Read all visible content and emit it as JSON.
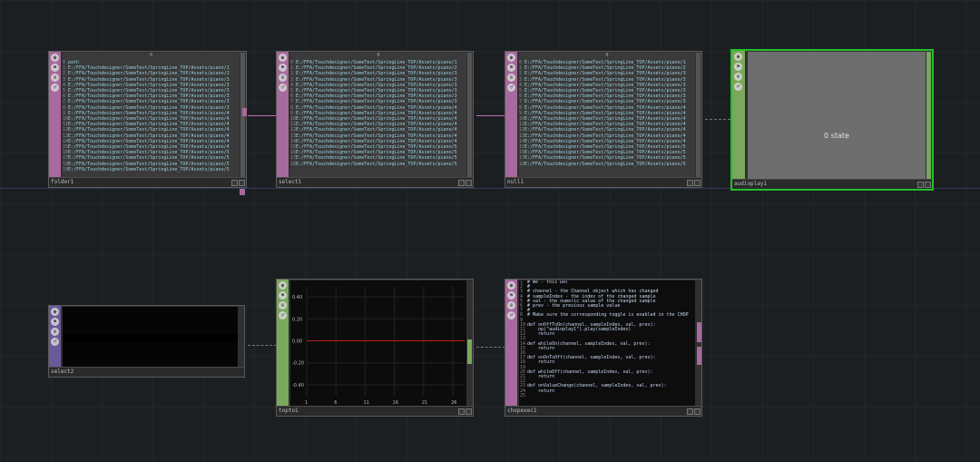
{
  "colors": {
    "dat": "#a66a9e",
    "chop": "#7aa85c",
    "selected": "#22c02a",
    "wire_dat": "#c46aae",
    "wire_chop": "#888888"
  },
  "nodes": {
    "folder1": {
      "name": "folder1",
      "header": "0",
      "rows": [
        "path",
        "E:/FFA/Touchdesigner/SomeTest/SpringLine_TOP/Assets/piano/1",
        "E:/FFA/Touchdesigner/SomeTest/SpringLine_TOP/Assets/piano/2",
        "E:/FFA/Touchdesigner/SomeTest/SpringLine_TOP/Assets/piano/3",
        "E:/FFA/Touchdesigner/SomeTest/SpringLine_TOP/Assets/piano/3",
        "E:/FFA/Touchdesigner/SomeTest/SpringLine_TOP/Assets/piano/3",
        "E:/FFA/Touchdesigner/SomeTest/SpringLine_TOP/Assets/piano/3",
        "E:/FFA/Touchdesigner/SomeTest/SpringLine_TOP/Assets/piano/3",
        "E:/FFA/Touchdesigner/SomeTest/SpringLine_TOP/Assets/piano/3",
        "E:/FFA/Touchdesigner/SomeTest/SpringLine_TOP/Assets/piano/4",
        "E:/FFA/Touchdesigner/SomeTest/SpringLine_TOP/Assets/piano/4",
        "E:/FFA/Touchdesigner/SomeTest/SpringLine_TOP/Assets/piano/4",
        "E:/FFA/Touchdesigner/SomeTest/SpringLine_TOP/Assets/piano/4",
        "E:/FFA/Touchdesigner/SomeTest/SpringLine_TOP/Assets/piano/4",
        "E:/FFA/Touchdesigner/SomeTest/SpringLine_TOP/Assets/piano/4",
        "E:/FFA/Touchdesigner/SomeTest/SpringLine_TOP/Assets/piano/4",
        "E:/FFA/Touchdesigner/SomeTest/SpringLine_TOP/Assets/piano/5",
        "E:/FFA/Touchdesigner/SomeTest/SpringLine_TOP/Assets/piano/5",
        "E:/FFA/Touchdesigner/SomeTest/SpringLine_TOP/Assets/piano/5",
        "E:/FFA/Touchdesigner/SomeTest/SpringLine_TOP/Assets/piano/5"
      ]
    },
    "select1": {
      "name": "select1",
      "header": "0",
      "rows": [
        "E:/FFA/Touchdesigner/SomeTest/SpringLine_TOP/Assets/piano/1",
        "E:/FFA/Touchdesigner/SomeTest/SpringLine_TOP/Assets/piano/2",
        "E:/FFA/Touchdesigner/SomeTest/SpringLine_TOP/Assets/piano/3",
        "E:/FFA/Touchdesigner/SomeTest/SpringLine_TOP/Assets/piano/3",
        "E:/FFA/Touchdesigner/SomeTest/SpringLine_TOP/Assets/piano/3",
        "E:/FFA/Touchdesigner/SomeTest/SpringLine_TOP/Assets/piano/3",
        "E:/FFA/Touchdesigner/SomeTest/SpringLine_TOP/Assets/piano/3",
        "E:/FFA/Touchdesigner/SomeTest/SpringLine_TOP/Assets/piano/3",
        "E:/FFA/Touchdesigner/SomeTest/SpringLine_TOP/Assets/piano/4",
        "E:/FFA/Touchdesigner/SomeTest/SpringLine_TOP/Assets/piano/4",
        "E:/FFA/Touchdesigner/SomeTest/SpringLine_TOP/Assets/piano/4",
        "E:/FFA/Touchdesigner/SomeTest/SpringLine_TOP/Assets/piano/4",
        "E:/FFA/Touchdesigner/SomeTest/SpringLine_TOP/Assets/piano/4",
        "E:/FFA/Touchdesigner/SomeTest/SpringLine_TOP/Assets/piano/4",
        "E:/FFA/Touchdesigner/SomeTest/SpringLine_TOP/Assets/piano/4",
        "E:/FFA/Touchdesigner/SomeTest/SpringLine_TOP/Assets/piano/5",
        "E:/FFA/Touchdesigner/SomeTest/SpringLine_TOP/Assets/piano/5",
        "E:/FFA/Touchdesigner/SomeTest/SpringLine_TOP/Assets/piano/5",
        "E:/FFA/Touchdesigner/SomeTest/SpringLine_TOP/Assets/piano/5"
      ]
    },
    "null1": {
      "name": "null1",
      "header": "0",
      "rows": [
        "E:/FFA/Touchdesigner/SomeTest/SpringLine_TOP/Assets/piano/1",
        "E:/FFA/Touchdesigner/SomeTest/SpringLine_TOP/Assets/piano/2",
        "E:/FFA/Touchdesigner/SomeTest/SpringLine_TOP/Assets/piano/3",
        "E:/FFA/Touchdesigner/SomeTest/SpringLine_TOP/Assets/piano/3",
        "E:/FFA/Touchdesigner/SomeTest/SpringLine_TOP/Assets/piano/3",
        "E:/FFA/Touchdesigner/SomeTest/SpringLine_TOP/Assets/piano/3",
        "E:/FFA/Touchdesigner/SomeTest/SpringLine_TOP/Assets/piano/3",
        "E:/FFA/Touchdesigner/SomeTest/SpringLine_TOP/Assets/piano/3",
        "E:/FFA/Touchdesigner/SomeTest/SpringLine_TOP/Assets/piano/4",
        "E:/FFA/Touchdesigner/SomeTest/SpringLine_TOP/Assets/piano/4",
        "E:/FFA/Touchdesigner/SomeTest/SpringLine_TOP/Assets/piano/4",
        "E:/FFA/Touchdesigner/SomeTest/SpringLine_TOP/Assets/piano/4",
        "E:/FFA/Touchdesigner/SomeTest/SpringLine_TOP/Assets/piano/4",
        "E:/FFA/Touchdesigner/SomeTest/SpringLine_TOP/Assets/piano/4",
        "E:/FFA/Touchdesigner/SomeTest/SpringLine_TOP/Assets/piano/4",
        "E:/FFA/Touchdesigner/SomeTest/SpringLine_TOP/Assets/piano/5",
        "E:/FFA/Touchdesigner/SomeTest/SpringLine_TOP/Assets/piano/5",
        "E:/FFA/Touchdesigner/SomeTest/SpringLine_TOP/Assets/piano/5",
        "E:/FFA/Touchdesigner/SomeTest/SpringLine_TOP/Assets/piano/5"
      ]
    },
    "audioplay1": {
      "name": "audioplay1",
      "state_label": "0 state"
    },
    "select2": {
      "name": "select2"
    },
    "topto1": {
      "name": "topto1"
    },
    "chopexec1": {
      "name": "chopexec1",
      "code": [
        "# me - this DAT",
        "#",
        "# channel - the Channel object which has changed",
        "# sampleIndex - the index of the changed sample",
        "# val - the numeric value of the changed sample",
        "# prev - the previous sample value",
        "#",
        "# Make sure the corresponding toggle is enabled in the CHOP",
        "",
        "def onOffToOn(channel, sampleIndex, val, prev):",
        "    op(\"audioplay1\").play(sampleIndex)",
        "    return",
        "",
        "def whileOn(channel, sampleIndex, val, prev):",
        "    return",
        "",
        "def onOnToOff(channel, sampleIndex, val, prev):",
        "    return",
        "",
        "def whileOff(channel, sampleIndex, val, prev):",
        "    return",
        "",
        "def onValueChange(channel, sampleIndex, val, prev):",
        "    return",
        ""
      ]
    }
  },
  "chart_data": {
    "type": "line",
    "title": "",
    "xlabel": "",
    "ylabel": "",
    "x_ticks": [
      "1",
      "6",
      "11",
      "16",
      "21",
      "26"
    ],
    "y_ticks": [
      "0.40",
      "0.20",
      "0.00",
      "-0.20",
      "-0.40"
    ],
    "xlim": [
      1,
      28
    ],
    "ylim": [
      -0.5,
      0.5
    ],
    "grid": true,
    "series": [
      {
        "values_constant": 0.0
      }
    ]
  }
}
